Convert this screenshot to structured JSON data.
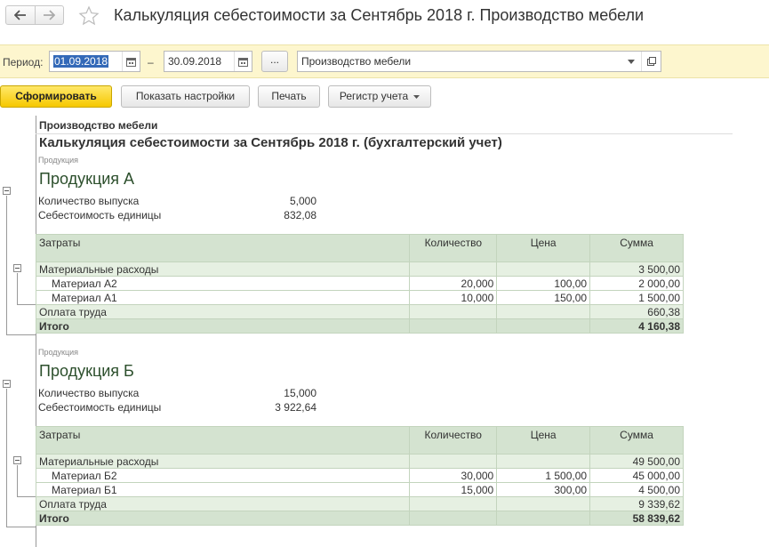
{
  "window": {
    "title": "Калькуляция себестоимости за Сентябрь 2018 г. Производство мебели"
  },
  "params": {
    "period_label": "Период:",
    "date_from": "01.09.2018",
    "date_to": "30.09.2018",
    "dash": "–",
    "dots": "...",
    "organization": "Производство мебели"
  },
  "toolbar": {
    "generate": "Сформировать",
    "show_settings": "Показать настройки",
    "print": "Печать",
    "register": "Регистр учета"
  },
  "report": {
    "org": "Производство мебели",
    "title": "Калькуляция себестоимости за Сентябрь 2018 г. (бухгалтерский учет)",
    "columns": [
      "Затраты",
      "Количество",
      "Цена",
      "Сумма"
    ],
    "products": [
      {
        "caption": "Продукция",
        "name": "Продукция А",
        "qty_label": "Количество выпуска",
        "qty_value": "5,000",
        "cost_label": "Себестоимость единицы",
        "cost_value": "832,08",
        "material_label": "Материальные расходы",
        "material_sum": "3 500,00",
        "materials": [
          {
            "name": "Материал А2",
            "qty": "20,000",
            "price": "100,00",
            "sum": "2 000,00"
          },
          {
            "name": "Материал А1",
            "qty": "10,000",
            "price": "150,00",
            "sum": "1 500,00"
          }
        ],
        "labor_label": "Оплата труда",
        "labor_sum": "660,38",
        "total_label": "Итого",
        "total_sum": "4 160,38"
      },
      {
        "caption": "Продукция",
        "name": "Продукция Б",
        "qty_label": "Количество выпуска",
        "qty_value": "15,000",
        "cost_label": "Себестоимость единицы",
        "cost_value": "3 922,64",
        "material_label": "Материальные расходы",
        "material_sum": "49 500,00",
        "materials": [
          {
            "name": "Материал Б2",
            "qty": "30,000",
            "price": "1 500,00",
            "sum": "45 000,00"
          },
          {
            "name": "Материал Б1",
            "qty": "15,000",
            "price": "300,00",
            "sum": "4 500,00"
          }
        ],
        "labor_label": "Оплата труда",
        "labor_sum": "9 339,62",
        "total_label": "Итого",
        "total_sum": "58 839,62"
      }
    ]
  }
}
